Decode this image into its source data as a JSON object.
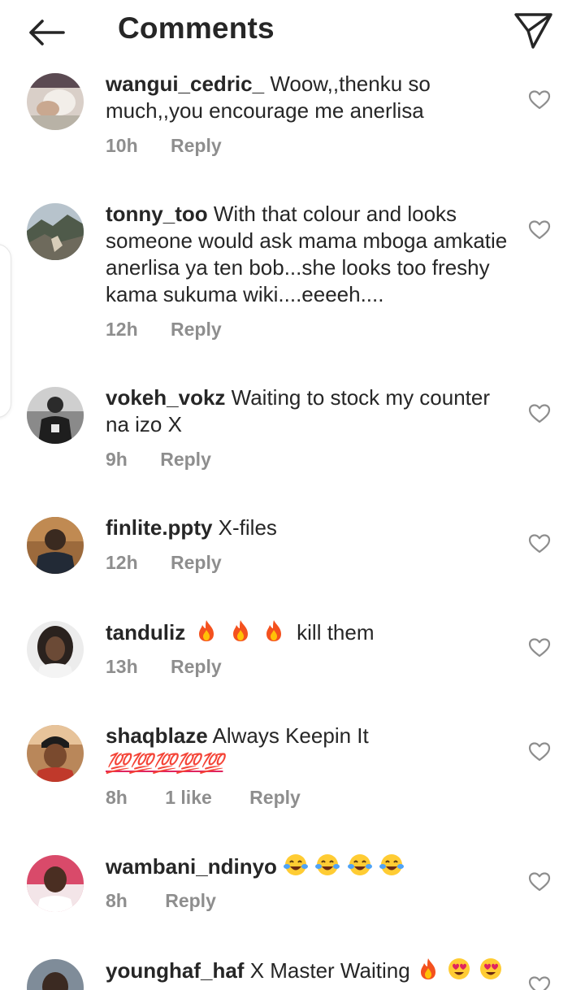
{
  "header": {
    "title": "Comments",
    "back_icon": "arrow-left-icon",
    "send_icon": "paper-plane-icon"
  },
  "colors": {
    "text": "#262626",
    "secondary": "#8e8e8e",
    "fire": "#f4511e",
    "emoji_yellow": "#ffcc33",
    "heart_eyes": "#e0245e"
  },
  "comments": [
    {
      "username": "wangui_cedric_",
      "text": "Woow,,thenku so much,,you encourage me anerlisa",
      "time": "10h",
      "likes": "",
      "reply_label": "Reply"
    },
    {
      "username": "tonny_too",
      "text": "With that colour and looks someone would ask mama mboga amkatie anerlisa ya ten bob...she looks too freshy kama sukuma wiki....eeeeh....",
      "time": "12h",
      "likes": "",
      "reply_label": "Reply"
    },
    {
      "username": "vokeh_vokz",
      "text": "Waiting to stock my counter na izo X",
      "time": "9h",
      "likes": "",
      "reply_label": "Reply"
    },
    {
      "username": "finlite.ppty",
      "text": "X-files",
      "time": "12h",
      "likes": "",
      "reply_label": "Reply"
    },
    {
      "username": "tanduliz",
      "text_after_emoji": "kill them",
      "emoji": [
        "fire",
        "fire",
        "fire"
      ],
      "time": "13h",
      "likes": "",
      "reply_label": "Reply"
    },
    {
      "username": "shaqblaze",
      "text": "Always Keepin It",
      "emoji_line": "💯💯💯💯💯",
      "time": "8h",
      "likes": "1 like",
      "reply_label": "Reply"
    },
    {
      "username": "wambani_ndinyo",
      "emoji": [
        "face-with-tears-of-joy",
        "face-with-tears-of-joy",
        "face-with-tears-of-joy",
        "face-with-tears-of-joy"
      ],
      "time": "8h",
      "likes": "",
      "reply_label": "Reply"
    },
    {
      "username": "younghaf_haf",
      "text": "X Master Waiting",
      "emoji": [
        "fire",
        "heart-eyes",
        "heart-eyes"
      ],
      "time": "",
      "likes": "",
      "reply_label": ""
    }
  ]
}
